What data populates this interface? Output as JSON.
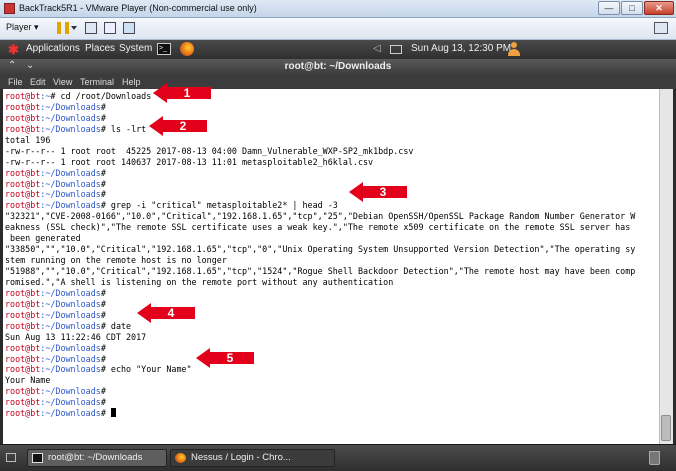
{
  "vmware": {
    "window_title": "BackTrack5R1 - VMware Player (Non-commercial use only)",
    "player_menu": "Player ▾",
    "minimize": "—",
    "maximize": "□",
    "close": "✕"
  },
  "gnome_panel": {
    "applications": "Applications",
    "places": "Places",
    "system": "System",
    "clock": "Sun Aug 13, 12:30 PM"
  },
  "terminal_window": {
    "title": "root@bt: ~/Downloads",
    "menu": [
      "File",
      "Edit",
      "View",
      "Terminal",
      "Help"
    ]
  },
  "terminal": {
    "prompt_user": "root@bt",
    "prompt_path": ":~/Downloads",
    "prompt_suffix": "# ",
    "lines": [
      {
        "type": "prompt",
        "path": ":~",
        "cmd": "cd /root/Downloads"
      },
      {
        "type": "prompt",
        "cmd": ""
      },
      {
        "type": "prompt",
        "cmd": ""
      },
      {
        "type": "prompt",
        "cmd": "ls -lrt"
      },
      {
        "type": "output",
        "text": "total 196"
      },
      {
        "type": "output",
        "text": "-rw-r--r-- 1 root root  45225 2017-08-13 04:00 Damn_Vulnerable_WXP-SP2_mk1bdp.csv"
      },
      {
        "type": "output",
        "text": "-rw-r--r-- 1 root root 140637 2017-08-13 11:01 metasploitable2_h6klal.csv"
      },
      {
        "type": "prompt",
        "cmd": ""
      },
      {
        "type": "prompt",
        "cmd": ""
      },
      {
        "type": "prompt",
        "cmd": ""
      },
      {
        "type": "prompt",
        "cmd": "grep -i \"critical\" metasploitable2* | head -3"
      },
      {
        "type": "output",
        "text": "\"32321\",\"CVE-2008-0166\",\"10.0\",\"Critical\",\"192.168.1.65\",\"tcp\",\"25\",\"Debian OpenSSH/OpenSSL Package Random Number Generator W"
      },
      {
        "type": "output",
        "text": "eakness (SSL check)\",\"The remote SSL certificate uses a weak key.\",\"The remote x509 certificate on the remote SSL server has"
      },
      {
        "type": "output",
        "text": " been generated"
      },
      {
        "type": "output",
        "text": "\"33850\",\"\",\"10.0\",\"Critical\",\"192.168.1.65\",\"tcp\",\"0\",\"Unix Operating System Unsupported Version Detection\",\"The operating sy"
      },
      {
        "type": "output",
        "text": "stem running on the remote host is no longer"
      },
      {
        "type": "output",
        "text": "\"51988\",\"\",\"10.0\",\"Critical\",\"192.168.1.65\",\"tcp\",\"1524\",\"Rogue Shell Backdoor Detection\",\"The remote host may have been comp"
      },
      {
        "type": "output",
        "text": "romised.\",\"A shell is listening on the remote port without any authentication"
      },
      {
        "type": "prompt",
        "cmd": ""
      },
      {
        "type": "prompt",
        "cmd": ""
      },
      {
        "type": "prompt",
        "cmd": ""
      },
      {
        "type": "prompt",
        "cmd": "date"
      },
      {
        "type": "output",
        "text": "Sun Aug 13 11:22:46 CDT 2017"
      },
      {
        "type": "prompt",
        "cmd": ""
      },
      {
        "type": "prompt",
        "cmd": ""
      },
      {
        "type": "prompt",
        "cmd": "echo \"Your Name\""
      },
      {
        "type": "output",
        "text": "Your Name"
      },
      {
        "type": "prompt",
        "cmd": ""
      },
      {
        "type": "prompt",
        "cmd": ""
      },
      {
        "type": "prompt",
        "cmd": "",
        "cursor": true
      }
    ]
  },
  "callouts": [
    "1",
    "2",
    "3",
    "4",
    "5"
  ],
  "taskbar": {
    "terminal_task": "root@bt: ~/Downloads",
    "browser_task": "Nessus / Login - Chro..."
  },
  "colors": {
    "prompt_user": "#c4001e",
    "prompt_path": "#2d55c8",
    "callout_red": "#e3001b"
  }
}
